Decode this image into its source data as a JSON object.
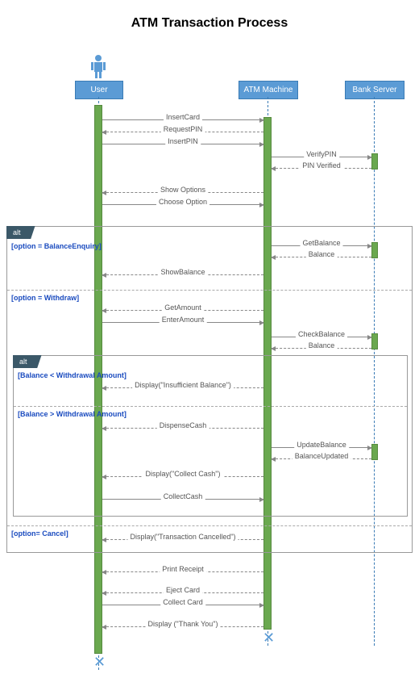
{
  "title": "ATM Transaction Process",
  "participants": {
    "user": "User",
    "atm": "ATM Machine",
    "bank": "Bank Server"
  },
  "messages": {
    "m1": "InsertCard",
    "m2": "RequestPIN",
    "m3": "InsertPIN",
    "m4": "VerifyPIN",
    "m5": "PIN Verified",
    "m6": "Show Options",
    "m7": "Choose Option",
    "m8": "GetBalance",
    "m9": "Balance",
    "m10": "ShowBalance",
    "m11": "GetAmount",
    "m12": "EnterAmount",
    "m13": "CheckBalance",
    "m14": "Balance",
    "m15": "Display(\"Insufficient Balance\")",
    "m16": "DispenseCash",
    "m17": "UpdateBalance",
    "m18": "BalanceUpdated",
    "m19": "Display(\"Collect Cash\")",
    "m20": "CollectCash",
    "m21": "Display(\"Transaction Cancelled\")",
    "m22": "Print Receipt",
    "m23": "Eject Card",
    "m24": "Collect Card",
    "m25": "Display (\"Thank You\")"
  },
  "frames": {
    "alt1": "alt",
    "alt2": "alt"
  },
  "guards": {
    "g1": "[option = BalanceEnquiry]",
    "g2": "[option = Withdraw]",
    "g3": "[Balance < Withdrawal Amount]",
    "g4": "[Balance > Withdrawal Amount]",
    "g5": "[option= Cancel]"
  },
  "chart_data": {
    "type": "sequence-diagram",
    "title": "ATM Transaction Process",
    "participants": [
      "User",
      "ATM Machine",
      "Bank Server"
    ],
    "sequence": [
      {
        "from": "User",
        "to": "ATM Machine",
        "label": "InsertCard",
        "kind": "sync"
      },
      {
        "from": "ATM Machine",
        "to": "User",
        "label": "RequestPIN",
        "kind": "return"
      },
      {
        "from": "User",
        "to": "ATM Machine",
        "label": "InsertPIN",
        "kind": "sync"
      },
      {
        "from": "ATM Machine",
        "to": "Bank Server",
        "label": "VerifyPIN",
        "kind": "sync"
      },
      {
        "from": "Bank Server",
        "to": "ATM Machine",
        "label": "PIN Verified",
        "kind": "return"
      },
      {
        "from": "ATM Machine",
        "to": "User",
        "label": "Show Options",
        "kind": "return"
      },
      {
        "from": "User",
        "to": "ATM Machine",
        "label": "Choose Option",
        "kind": "sync"
      },
      {
        "frame": "alt",
        "sections": [
          {
            "guard": "[option = BalanceEnquiry]",
            "messages": [
              {
                "from": "ATM Machine",
                "to": "Bank Server",
                "label": "GetBalance",
                "kind": "sync"
              },
              {
                "from": "Bank Server",
                "to": "ATM Machine",
                "label": "Balance",
                "kind": "return"
              },
              {
                "from": "ATM Machine",
                "to": "User",
                "label": "ShowBalance",
                "kind": "return"
              }
            ]
          },
          {
            "guard": "[option = Withdraw]",
            "messages": [
              {
                "from": "ATM Machine",
                "to": "User",
                "label": "GetAmount",
                "kind": "return"
              },
              {
                "from": "User",
                "to": "ATM Machine",
                "label": "EnterAmount",
                "kind": "sync"
              },
              {
                "from": "ATM Machine",
                "to": "Bank Server",
                "label": "CheckBalance",
                "kind": "sync"
              },
              {
                "from": "Bank Server",
                "to": "ATM Machine",
                "label": "Balance",
                "kind": "return"
              },
              {
                "frame": "alt",
                "sections": [
                  {
                    "guard": "[Balance < Withdrawal Amount]",
                    "messages": [
                      {
                        "from": "ATM Machine",
                        "to": "User",
                        "label": "Display(\"Insufficient Balance\")",
                        "kind": "return"
                      }
                    ]
                  },
                  {
                    "guard": "[Balance > Withdrawal Amount]",
                    "messages": [
                      {
                        "from": "ATM Machine",
                        "to": "User",
                        "label": "DispenseCash",
                        "kind": "return"
                      },
                      {
                        "from": "ATM Machine",
                        "to": "Bank Server",
                        "label": "UpdateBalance",
                        "kind": "sync"
                      },
                      {
                        "from": "Bank Server",
                        "to": "ATM Machine",
                        "label": "BalanceUpdated",
                        "kind": "return"
                      },
                      {
                        "from": "ATM Machine",
                        "to": "User",
                        "label": "Display(\"Collect Cash\")",
                        "kind": "return"
                      },
                      {
                        "from": "User",
                        "to": "ATM Machine",
                        "label": "CollectCash",
                        "kind": "sync"
                      }
                    ]
                  }
                ]
              }
            ]
          },
          {
            "guard": "[option= Cancel]",
            "messages": [
              {
                "from": "ATM Machine",
                "to": "User",
                "label": "Display(\"Transaction Cancelled\")",
                "kind": "return"
              }
            ]
          }
        ]
      },
      {
        "from": "ATM Machine",
        "to": "User",
        "label": "Print Receipt",
        "kind": "return"
      },
      {
        "from": "ATM Machine",
        "to": "User",
        "label": "Eject Card",
        "kind": "return"
      },
      {
        "from": "User",
        "to": "ATM Machine",
        "label": "Collect Card",
        "kind": "sync"
      },
      {
        "from": "ATM Machine",
        "to": "User",
        "label": "Display (\"Thank You\")",
        "kind": "return"
      }
    ]
  }
}
